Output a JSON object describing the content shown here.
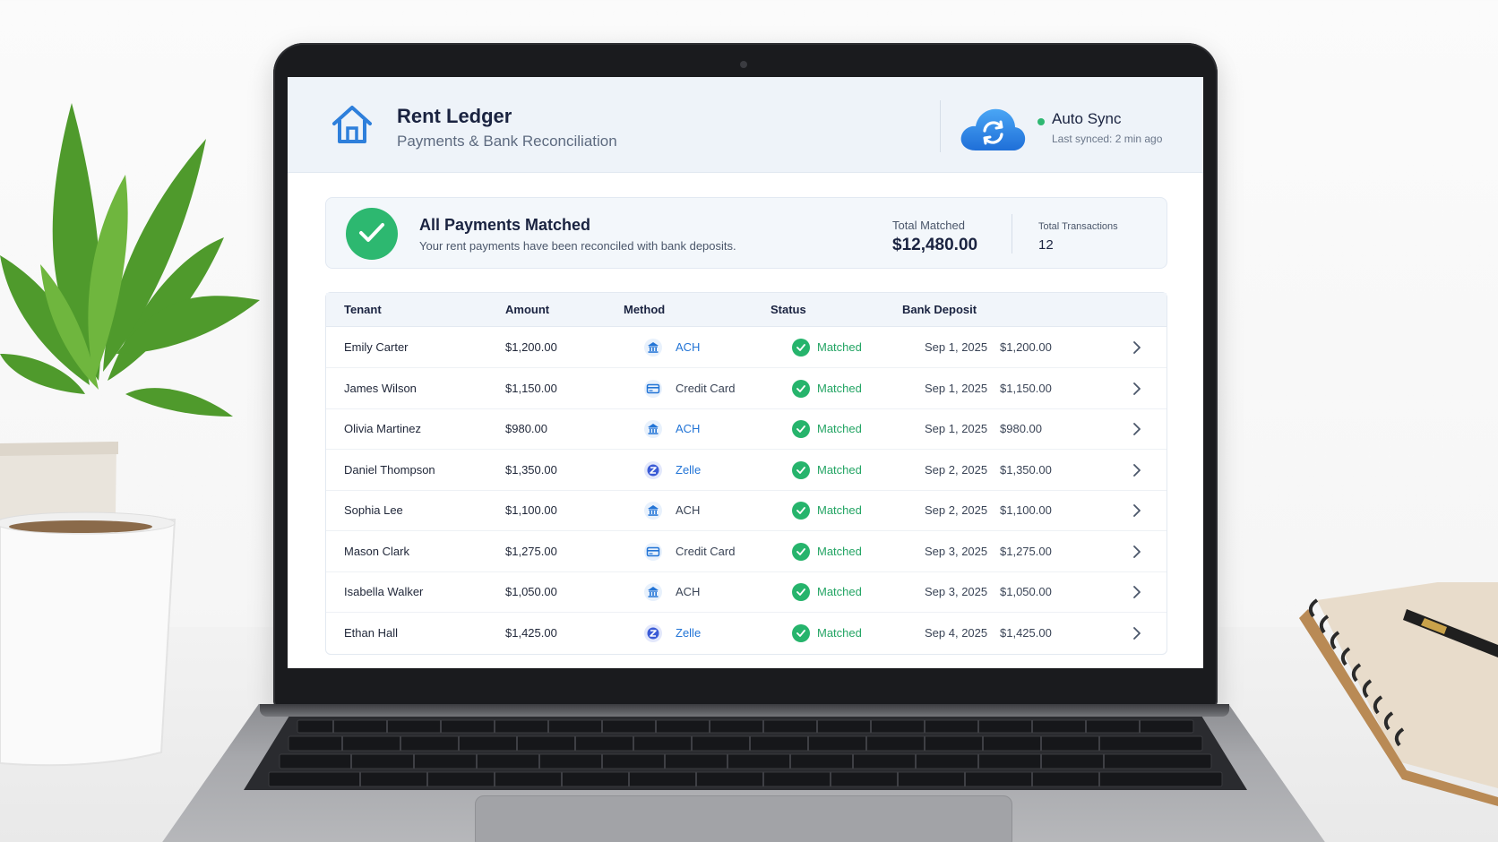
{
  "app": {
    "title": "Rent Ledger",
    "subtitle": "Payments & Bank Reconciliation",
    "icon": "home-icon"
  },
  "sync": {
    "title": "Auto Sync",
    "last_synced": "Last synced: 2 min ago",
    "status_color": "#2fb872",
    "icon": "cloud-sync-icon"
  },
  "summary": {
    "title": "All Payments Matched",
    "subtitle": "Your rent payments have been reconciled with bank deposits.",
    "total_matched_label": "Total Matched",
    "total_matched_value": "$12,480.00",
    "total_transactions_label": "Total Transactions",
    "total_transactions_value": "12",
    "icon": "check-circle-icon"
  },
  "table": {
    "columns": [
      "Tenant",
      "Amount",
      "Method",
      "Status",
      "Bank Deposit"
    ],
    "rows": [
      {
        "tenant": "Emily Carter",
        "amount": "$1,200.00",
        "method": "ACH",
        "method_icon": "bank-icon",
        "status": "Matched",
        "deposit_date": "Sep 1, 2025",
        "deposit_amount": "$1,200.00"
      },
      {
        "tenant": "James Wilson",
        "amount": "$1,150.00",
        "method": "Credit Card",
        "method_icon": "credit-card-icon",
        "status": "Matched",
        "deposit_date": "Sep 1, 2025",
        "deposit_amount": "$1,150.00"
      },
      {
        "tenant": "Olivia Martinez",
        "amount": "$980.00",
        "method": "ACH",
        "method_icon": "bank-icon",
        "status": "Matched",
        "deposit_date": "Sep 1, 2025",
        "deposit_amount": "$980.00"
      },
      {
        "tenant": "Daniel Thompson",
        "amount": "$1,350.00",
        "method": "Zelle",
        "method_icon": "zelle-icon",
        "status": "Matched",
        "deposit_date": "Sep 2, 2025",
        "deposit_amount": "$1,350.00"
      },
      {
        "tenant": "Sophia Lee",
        "amount": "$1,100.00",
        "method": "ACH",
        "method_icon": "bank-icon",
        "status": "Matched",
        "deposit_date": "Sep 2, 2025",
        "deposit_amount": "$1,100.00"
      },
      {
        "tenant": "Mason Clark",
        "amount": "$1,275.00",
        "method": "Credit Card",
        "method_icon": "credit-card-icon",
        "status": "Matched",
        "deposit_date": "Sep 3, 2025",
        "deposit_amount": "$1,275.00"
      },
      {
        "tenant": "Isabella Walker",
        "amount": "$1,050.00",
        "method": "ACH",
        "method_icon": "bank-icon",
        "status": "Matched",
        "deposit_date": "Sep 3, 2025",
        "deposit_amount": "$1,050.00"
      },
      {
        "tenant": "Ethan Hall",
        "amount": "$1,425.00",
        "method": "Zelle",
        "method_icon": "zelle-icon",
        "status": "Matched",
        "deposit_date": "Sep 4, 2025",
        "deposit_amount": "$1,425.00"
      }
    ]
  },
  "colors": {
    "accent_blue": "#2274d6",
    "matched_green": "#26b46c",
    "header_bg": "#eef3f9"
  }
}
